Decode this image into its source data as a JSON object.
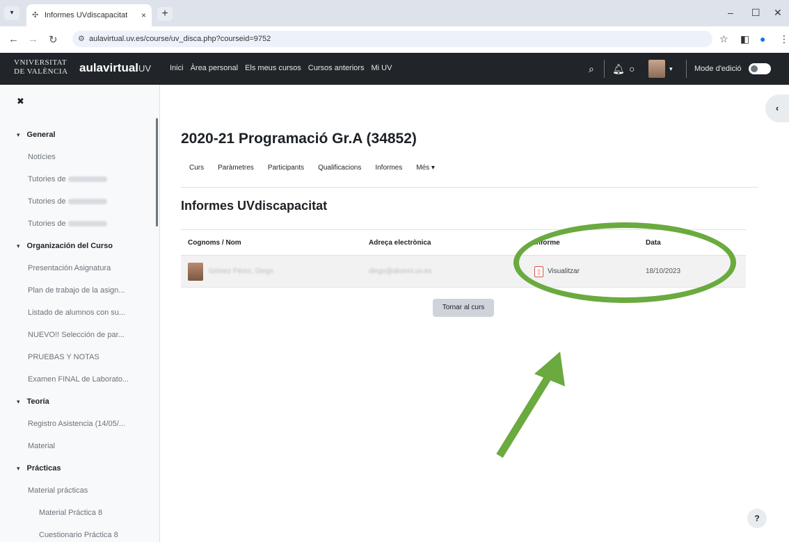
{
  "browser": {
    "tab_title": "Informes UVdiscapacitat",
    "tab_close": "×",
    "new_tab": "+",
    "url": "aulavirtual.uv.es/course/uv_disca.php?courseid=9752"
  },
  "site": {
    "logo_university": "VNIVERSITAT DE VALÈNCIA",
    "logo_aula": "aulavirtual",
    "logo_uv": "UV",
    "menu": [
      "Inici",
      "Àrea personal",
      "Els meus cursos",
      "Cursos anteriors",
      "Mi UV"
    ],
    "edit_mode_label": "Mode d'edició"
  },
  "sidebar": {
    "sections": [
      {
        "label": "General",
        "items": [
          {
            "label": "Notícies",
            "redacted": false
          },
          {
            "label": "Tutories de",
            "redacted": true
          },
          {
            "label": "Tutories de",
            "redacted": true
          },
          {
            "label": "Tutories de",
            "redacted": true
          }
        ]
      },
      {
        "label": "Organización del Curso",
        "items": [
          {
            "label": "Presentación Asignatura",
            "redacted": false
          },
          {
            "label": "Plan de trabajo de la asign...",
            "redacted": false
          },
          {
            "label": "Listado de alumnos con su...",
            "redacted": false
          },
          {
            "label": "NUEVO!! Selección de par...",
            "redacted": false
          },
          {
            "label": "PRUEBAS Y NOTAS",
            "redacted": false
          },
          {
            "label": "Examen FINAL de Laborato...",
            "redacted": false
          }
        ]
      },
      {
        "label": "Teoría",
        "items": [
          {
            "label": "Registro Asistencia (14/05/...",
            "redacted": false
          },
          {
            "label": "Material",
            "redacted": false
          }
        ]
      },
      {
        "label": "Prácticas",
        "items": [
          {
            "label": "Material prácticas",
            "redacted": false
          },
          {
            "label": "Material Práctica 8",
            "redacted": false,
            "sub": true
          },
          {
            "label": "Cuestionario Práctica 8",
            "redacted": false,
            "sub": true
          }
        ]
      }
    ]
  },
  "course": {
    "title": "2020-21 Programació Gr.A (34852)",
    "nav": [
      "Curs",
      "Paràmetres",
      "Participants",
      "Qualificacions",
      "Informes",
      "Més ▾"
    ]
  },
  "report": {
    "heading": "Informes UVdiscapacitat",
    "columns": [
      "Cognoms / Nom",
      "Adreça electrònica",
      "Informe",
      "Data"
    ],
    "rows": [
      {
        "name": "Gómez Pérez, Diego",
        "email": "diego@alumni.uv.es",
        "report": "Visualitzar",
        "date": "18/10/2023"
      }
    ],
    "back_button": "Tornar al curs"
  },
  "help": "?",
  "colors": {
    "navbar": "#212529",
    "annotation": "#6aaa3f",
    "pdf": "#d9534f"
  }
}
